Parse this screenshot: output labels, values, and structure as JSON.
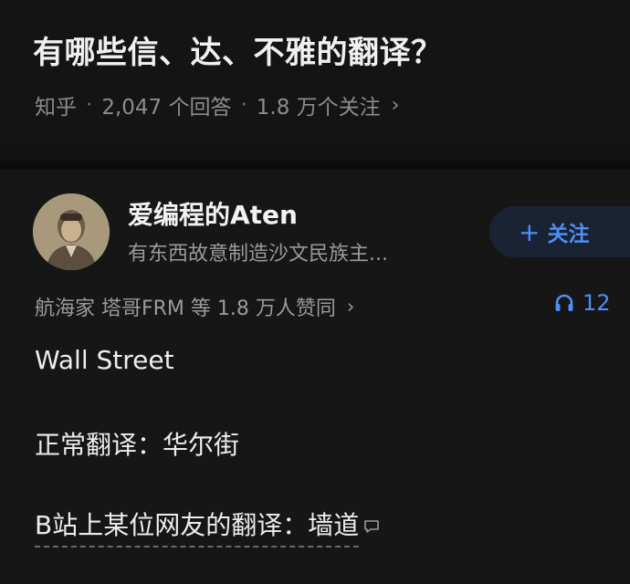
{
  "question": {
    "title": "有哪些信、达、不雅的翻译？",
    "source": "知乎",
    "answers": "2,047 个回答",
    "followers": "1.8 万个关注",
    "chevron": "›"
  },
  "author": {
    "name": "爱编程的Aten",
    "bio": "有东西故意制造沙文民族主...",
    "follow_label": "关注",
    "follow_plus": "+"
  },
  "endorsement": {
    "text": "航海家 塔哥FRM 等 1.8 万人赞同",
    "chevron": "›"
  },
  "listen": {
    "count": "12",
    "icon": "headphones-icon"
  },
  "answer": {
    "line1": "Wall Street",
    "line2": "正常翻译：华尔街",
    "line3": "B站上某位网友的翻译：墙道"
  },
  "colors": {
    "background": "#121212",
    "accent": "#4d8ef7",
    "muted": "#9a9a9a"
  }
}
